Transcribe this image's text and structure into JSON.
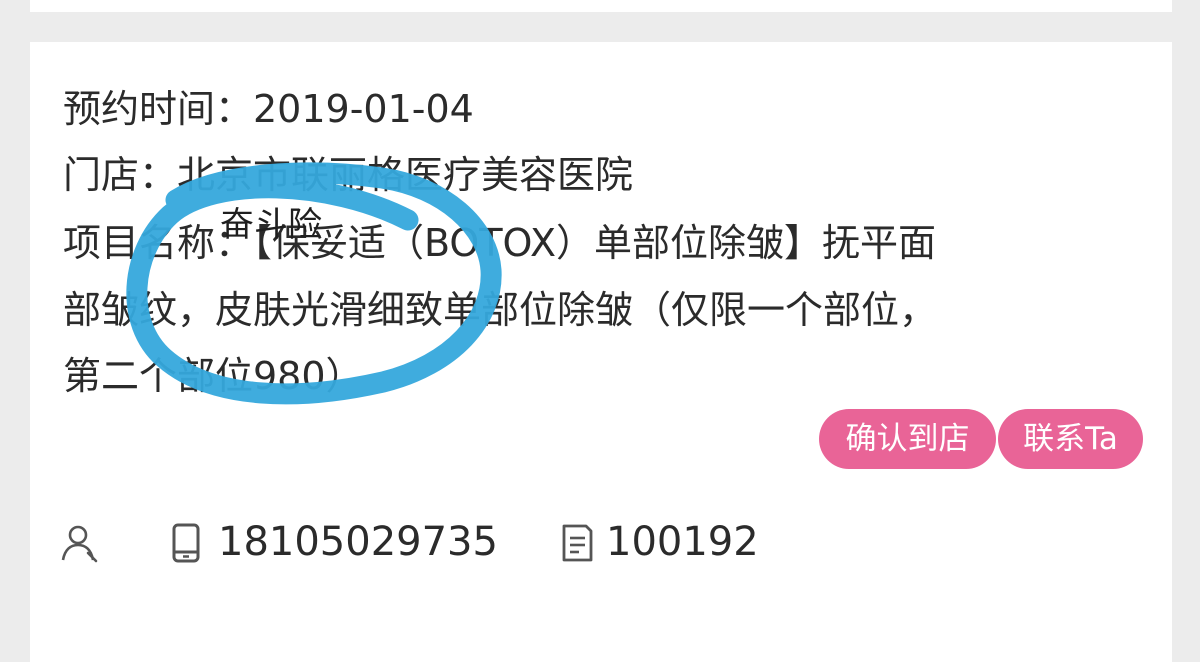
{
  "order": {
    "appointment_line": "预约时间：2019-01-04",
    "store_line": "门店：北京市联丽格医疗美容医院",
    "project_line_1": "项目名称：【保妥适（BOTOX）单部位除皱】抚平面",
    "project_line_2": "部皱纹，皮肤光滑细致单部位除皱（仅限一个部位，",
    "project_line_3": "第二个部位980）",
    "overlay_text": "奋斗险"
  },
  "actions": {
    "confirm_label": "确认到店",
    "contact_label": "联系Ta"
  },
  "customer": {
    "phone": "18105029735",
    "order_number": "100192"
  },
  "icons": {
    "user": "user-icon",
    "phone": "phone-icon",
    "order": "document-icon"
  },
  "colors": {
    "button": "#e96497",
    "scribble": "#35a8dc",
    "card": "#ffffff",
    "background": "#ececec"
  }
}
